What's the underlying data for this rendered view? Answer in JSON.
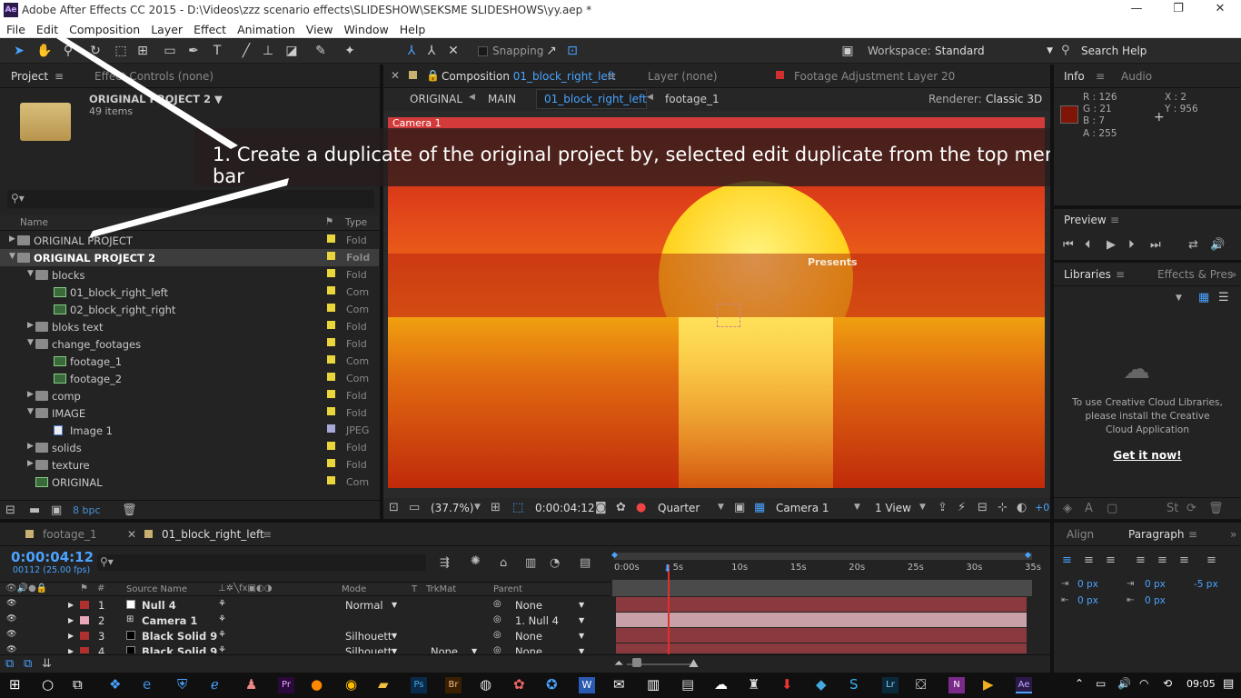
{
  "window": {
    "title": "Adobe After Effects CC 2015 - D:\\Videos\\zzz scenario effects\\SLIDESHOW\\SEKSME SLIDESHOWS\\yy.aep *",
    "logo": "Ae"
  },
  "menu": [
    "File",
    "Edit",
    "Composition",
    "Layer",
    "Effect",
    "Animation",
    "View",
    "Window",
    "Help"
  ],
  "toolbar": {
    "snapping": "Snapping",
    "workspace_label": "Workspace:",
    "workspace_value": "Standard",
    "search": "Search Help"
  },
  "project_panel": {
    "tab_project": "Project",
    "tab_effects": "Effect Controls (none)",
    "name": "ORIGINAL PROJECT 2 ▼",
    "count": "49 items",
    "col_name": "Name",
    "col_type": "Type",
    "bpc": "8 bpc",
    "items": [
      {
        "name": "ORIGINAL PROJECT",
        "type": "Fold",
        "depth": 0,
        "kind": "folder",
        "tri": "▶"
      },
      {
        "name": "ORIGINAL PROJECT 2",
        "type": "Fold",
        "depth": 0,
        "kind": "folder",
        "tri": "▼"
      },
      {
        "name": "blocks",
        "type": "Fold",
        "depth": 1,
        "kind": "folder",
        "tri": "▼"
      },
      {
        "name": "01_block_right_left",
        "type": "Com",
        "depth": 2,
        "kind": "comp",
        "tri": ""
      },
      {
        "name": "02_block_right_right",
        "type": "Com",
        "depth": 2,
        "kind": "comp",
        "tri": ""
      },
      {
        "name": "bloks text",
        "type": "Fold",
        "depth": 1,
        "kind": "folder",
        "tri": "▶"
      },
      {
        "name": "change_footages",
        "type": "Fold",
        "depth": 1,
        "kind": "folder",
        "tri": "▼"
      },
      {
        "name": "footage_1",
        "type": "Com",
        "depth": 2,
        "kind": "comp",
        "tri": ""
      },
      {
        "name": "footage_2",
        "type": "Com",
        "depth": 2,
        "kind": "comp",
        "tri": ""
      },
      {
        "name": "comp",
        "type": "Fold",
        "depth": 1,
        "kind": "folder",
        "tri": "▶"
      },
      {
        "name": "IMAGE",
        "type": "Fold",
        "depth": 1,
        "kind": "folder",
        "tri": "▼"
      },
      {
        "name": "Image 1",
        "type": "JPEG",
        "depth": 2,
        "kind": "image",
        "tri": ""
      },
      {
        "name": "solids",
        "type": "Fold",
        "depth": 1,
        "kind": "folder",
        "tri": "▶"
      },
      {
        "name": "texture",
        "type": "Fold",
        "depth": 1,
        "kind": "folder",
        "tri": "▶"
      },
      {
        "name": "ORIGINAL",
        "type": "Com",
        "depth": 1,
        "kind": "comp",
        "tri": ""
      }
    ]
  },
  "comp_panel": {
    "tab_comp_prefix": "Composition",
    "tab_comp_name": "01_block_right_left",
    "tab_layer": "Layer (none)",
    "tab_footage": "Footage Adjustment Layer 20",
    "crumbs": [
      "ORIGINAL",
      "MAIN",
      "01_block_right_left",
      "footage_1"
    ],
    "renderer_label": "Renderer:",
    "renderer_value": "Classic 3D",
    "camera_label": "Camera 1",
    "presents": "Presents",
    "zoom": "(37.7%)",
    "timecode": "0:00:04:12",
    "resolution": "Quarter",
    "camera": "Camera 1",
    "views": "1 View",
    "offset": "+0"
  },
  "annotation": "1.   Create a duplicate of the original project by, selected edit duplicate from the top menu bar",
  "info_panel": {
    "tab_info": "Info",
    "tab_audio": "Audio",
    "r": "R : 126",
    "g": "G : 21",
    "b": "B : 7",
    "a": "A : 255",
    "x": "X : 2",
    "y": "Y : 956",
    "swatch": "#7e1507"
  },
  "preview_panel": {
    "tab": "Preview"
  },
  "libraries_panel": {
    "tab": "Libraries",
    "tab2": "Effects & Pres",
    "message": "To use Creative Cloud Libraries, please install the Creative Cloud Application",
    "link": "Get it now!"
  },
  "paragraph_panel": {
    "tab_align": "Align",
    "tab_paragraph": "Paragraph",
    "v1": "0 px",
    "v2": "0 px",
    "v3": "-5 px",
    "v4": "0 px",
    "v5": "0 px"
  },
  "timeline": {
    "tab1": "footage_1",
    "tab2": "01_block_right_left",
    "timecode": "0:00:04:12",
    "frame": "00112 (25.00 fps)",
    "col_source": "Source Name",
    "col_mode": "Mode",
    "col_t": "T",
    "col_trkmat": "TrkMat",
    "col_parent": "Parent",
    "ticks": [
      "0:00s",
      "5s",
      "10s",
      "15s",
      "20s",
      "25s",
      "30s",
      "35s"
    ],
    "layers": [
      {
        "num": "1",
        "name": "Null 4",
        "mode": "Normal",
        "trkmat": "",
        "parent": "None",
        "color": "#b03030",
        "swatch": "#ffffff"
      },
      {
        "num": "2",
        "name": "Camera 1",
        "mode": "",
        "trkmat": "",
        "parent": "1. Null 4",
        "color": "#e8a8b8",
        "swatch": ""
      },
      {
        "num": "3",
        "name": "Black Solid 9",
        "mode": "Silhouett",
        "trkmat": "",
        "parent": "None",
        "color": "#b03030",
        "swatch": "#000000"
      },
      {
        "num": "4",
        "name": "Black Solid 9",
        "mode": "Silhouett",
        "trkmat": "None",
        "parent": "None",
        "color": "#b03030",
        "swatch": "#000000"
      }
    ]
  },
  "taskbar": {
    "time": "09:05"
  }
}
